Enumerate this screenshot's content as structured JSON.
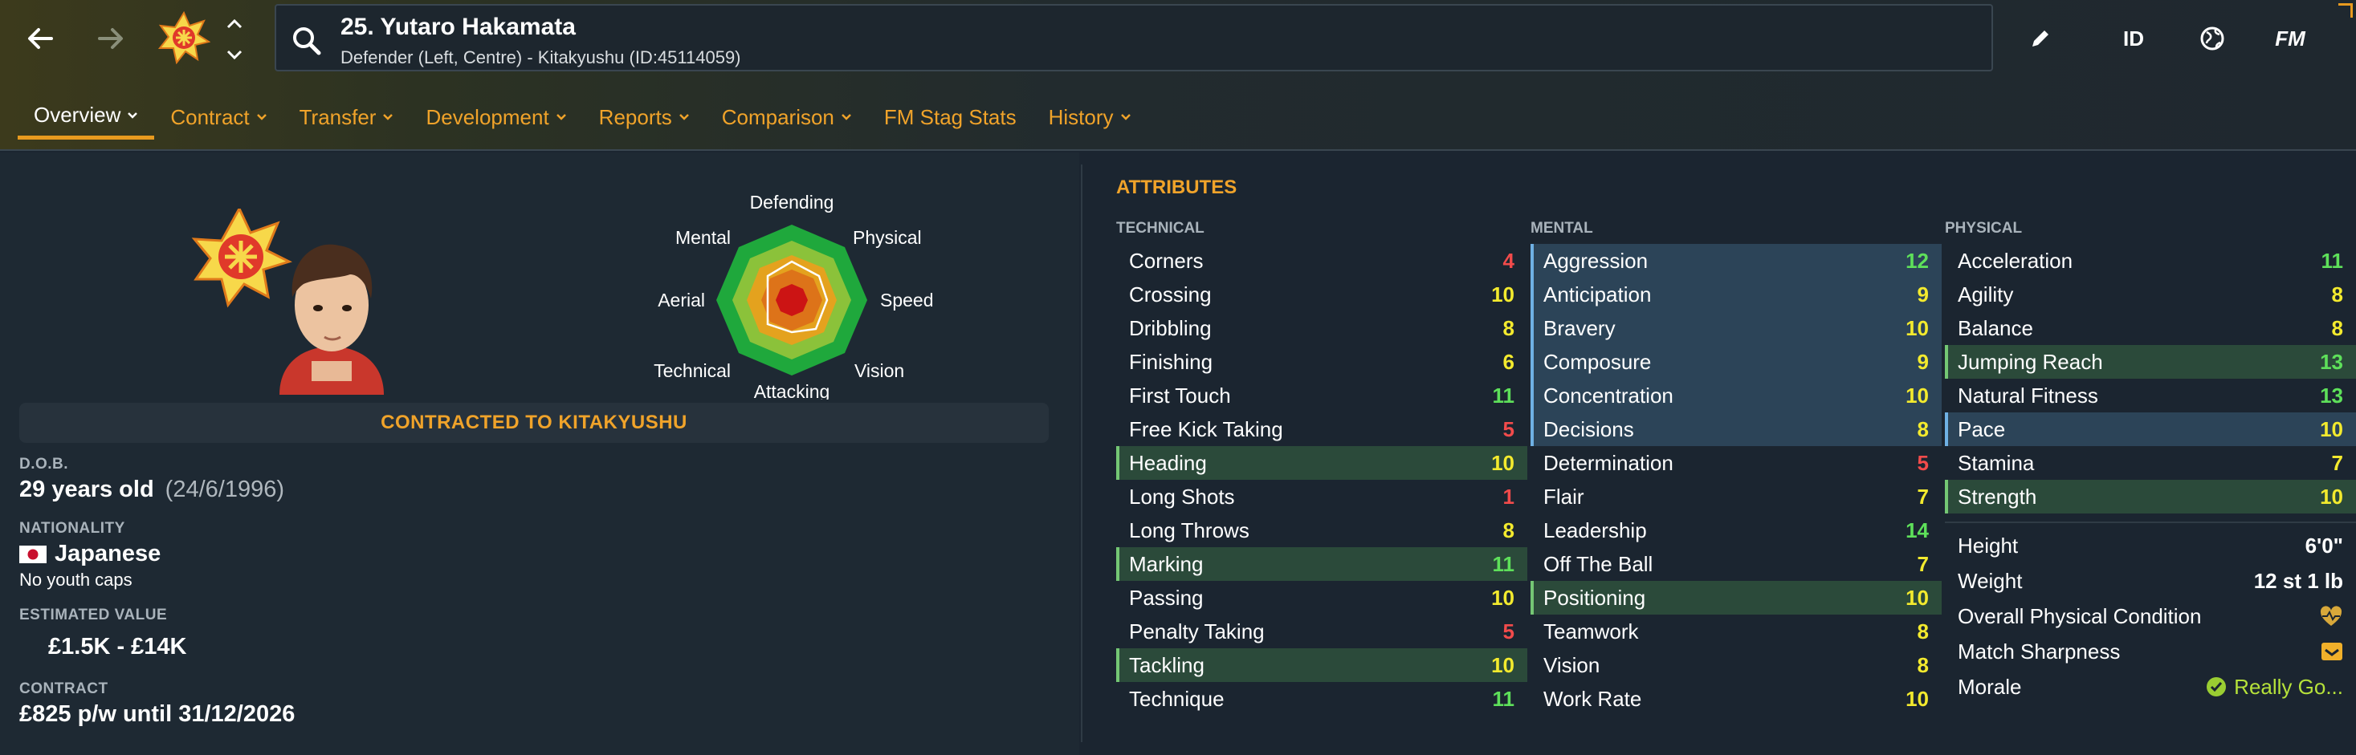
{
  "header": {
    "player_name": "25. Yutaro Hakamata",
    "player_sub": "Defender (Left, Centre) - Kitakyushu (ID:45114059)",
    "id_label": "ID",
    "fm_label": "FM"
  },
  "tabs": [
    {
      "label": "Overview",
      "has_chevron": true,
      "active": true
    },
    {
      "label": "Contract",
      "has_chevron": true
    },
    {
      "label": "Transfer",
      "has_chevron": true
    },
    {
      "label": "Development",
      "has_chevron": true
    },
    {
      "label": "Reports",
      "has_chevron": true
    },
    {
      "label": "Comparison",
      "has_chevron": true
    },
    {
      "label": "FM Stag Stats",
      "has_chevron": false
    },
    {
      "label": "History",
      "has_chevron": true
    }
  ],
  "radar": {
    "labels": {
      "defending": "Defending",
      "physical": "Physical",
      "speed": "Speed",
      "vision": "Vision",
      "attacking": "Attacking",
      "technical": "Technical",
      "aerial": "Aerial",
      "mental": "Mental"
    }
  },
  "profile": {
    "contract_banner": "CONTRACTED TO KITAKYUSHU",
    "dob_label": "D.O.B.",
    "age": "29 years old",
    "dob": "(24/6/1996)",
    "nationality_label": "NATIONALITY",
    "nationality": "Japanese",
    "youth_caps": "No youth caps",
    "value_label": "ESTIMATED VALUE",
    "value": "£1.5K - £14K",
    "contract_label": "CONTRACT",
    "contract": "£825 p/w until 31/12/2026"
  },
  "attributes": {
    "title": "ATTRIBUTES",
    "technical_label": "TECHNICAL",
    "mental_label": "MENTAL",
    "physical_label": "PHYSICAL",
    "technical": [
      {
        "name": "Corners",
        "value": "4",
        "hl": ""
      },
      {
        "name": "Crossing",
        "value": "10",
        "hl": ""
      },
      {
        "name": "Dribbling",
        "value": "8",
        "hl": ""
      },
      {
        "name": "Finishing",
        "value": "6",
        "hl": ""
      },
      {
        "name": "First Touch",
        "value": "11",
        "hl": ""
      },
      {
        "name": "Free Kick Taking",
        "value": "5",
        "hl": ""
      },
      {
        "name": "Heading",
        "value": "10",
        "hl": "green"
      },
      {
        "name": "Long Shots",
        "value": "1",
        "hl": ""
      },
      {
        "name": "Long Throws",
        "value": "8",
        "hl": ""
      },
      {
        "name": "Marking",
        "value": "11",
        "hl": "green"
      },
      {
        "name": "Passing",
        "value": "10",
        "hl": ""
      },
      {
        "name": "Penalty Taking",
        "value": "5",
        "hl": ""
      },
      {
        "name": "Tackling",
        "value": "10",
        "hl": "green"
      },
      {
        "name": "Technique",
        "value": "11",
        "hl": ""
      }
    ],
    "mental": [
      {
        "name": "Aggression",
        "value": "12",
        "hl": "blue"
      },
      {
        "name": "Anticipation",
        "value": "9",
        "hl": "blue"
      },
      {
        "name": "Bravery",
        "value": "10",
        "hl": "blue"
      },
      {
        "name": "Composure",
        "value": "9",
        "hl": "blue"
      },
      {
        "name": "Concentration",
        "value": "10",
        "hl": "blue"
      },
      {
        "name": "Decisions",
        "value": "8",
        "hl": "blue"
      },
      {
        "name": "Determination",
        "value": "5",
        "hl": ""
      },
      {
        "name": "Flair",
        "value": "7",
        "hl": ""
      },
      {
        "name": "Leadership",
        "value": "14",
        "hl": ""
      },
      {
        "name": "Off The Ball",
        "value": "7",
        "hl": ""
      },
      {
        "name": "Positioning",
        "value": "10",
        "hl": "green"
      },
      {
        "name": "Teamwork",
        "value": "8",
        "hl": ""
      },
      {
        "name": "Vision",
        "value": "8",
        "hl": ""
      },
      {
        "name": "Work Rate",
        "value": "10",
        "hl": ""
      }
    ],
    "physical": [
      {
        "name": "Acceleration",
        "value": "11",
        "hl": ""
      },
      {
        "name": "Agility",
        "value": "8",
        "hl": ""
      },
      {
        "name": "Balance",
        "value": "8",
        "hl": ""
      },
      {
        "name": "Jumping Reach",
        "value": "13",
        "hl": "green"
      },
      {
        "name": "Natural Fitness",
        "value": "13",
        "hl": ""
      },
      {
        "name": "Pace",
        "value": "10",
        "hl": "blue"
      },
      {
        "name": "Stamina",
        "value": "7",
        "hl": ""
      },
      {
        "name": "Strength",
        "value": "10",
        "hl": "green"
      }
    ],
    "info": {
      "height_label": "Height",
      "height": "6'0\"",
      "weight_label": "Weight",
      "weight": "12 st 1 lb",
      "condition_label": "Overall Physical Condition",
      "sharpness_label": "Match Sharpness",
      "morale_label": "Morale",
      "morale": "Really Go..."
    }
  },
  "colors": {
    "accent": "#f0a32a",
    "low": "#f24b4b",
    "mid": "#f3ea2e",
    "high": "#5ee05a"
  }
}
